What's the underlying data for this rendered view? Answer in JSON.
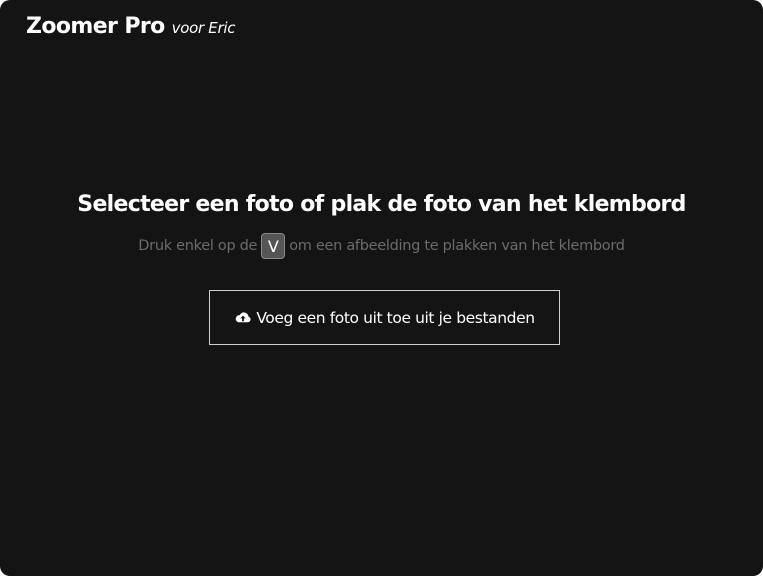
{
  "header": {
    "title": "Zoomer Pro",
    "subtitle": "voor Eric"
  },
  "main": {
    "headline": "Selecteer een foto of plak de foto van het klembord",
    "hint_before": "Druk enkel op de",
    "hint_key": "V",
    "hint_after": "om een afbeelding te plakken van het klembord",
    "upload_button_label": "Voeg een foto uit toe uit je bestanden",
    "upload_icon": "cloud-upload-icon"
  },
  "colors": {
    "background": "#141414",
    "text": "#ffffff",
    "hint_text": "#6b6b6b",
    "key_background": "#555555",
    "button_border": "#cfcfcf"
  }
}
